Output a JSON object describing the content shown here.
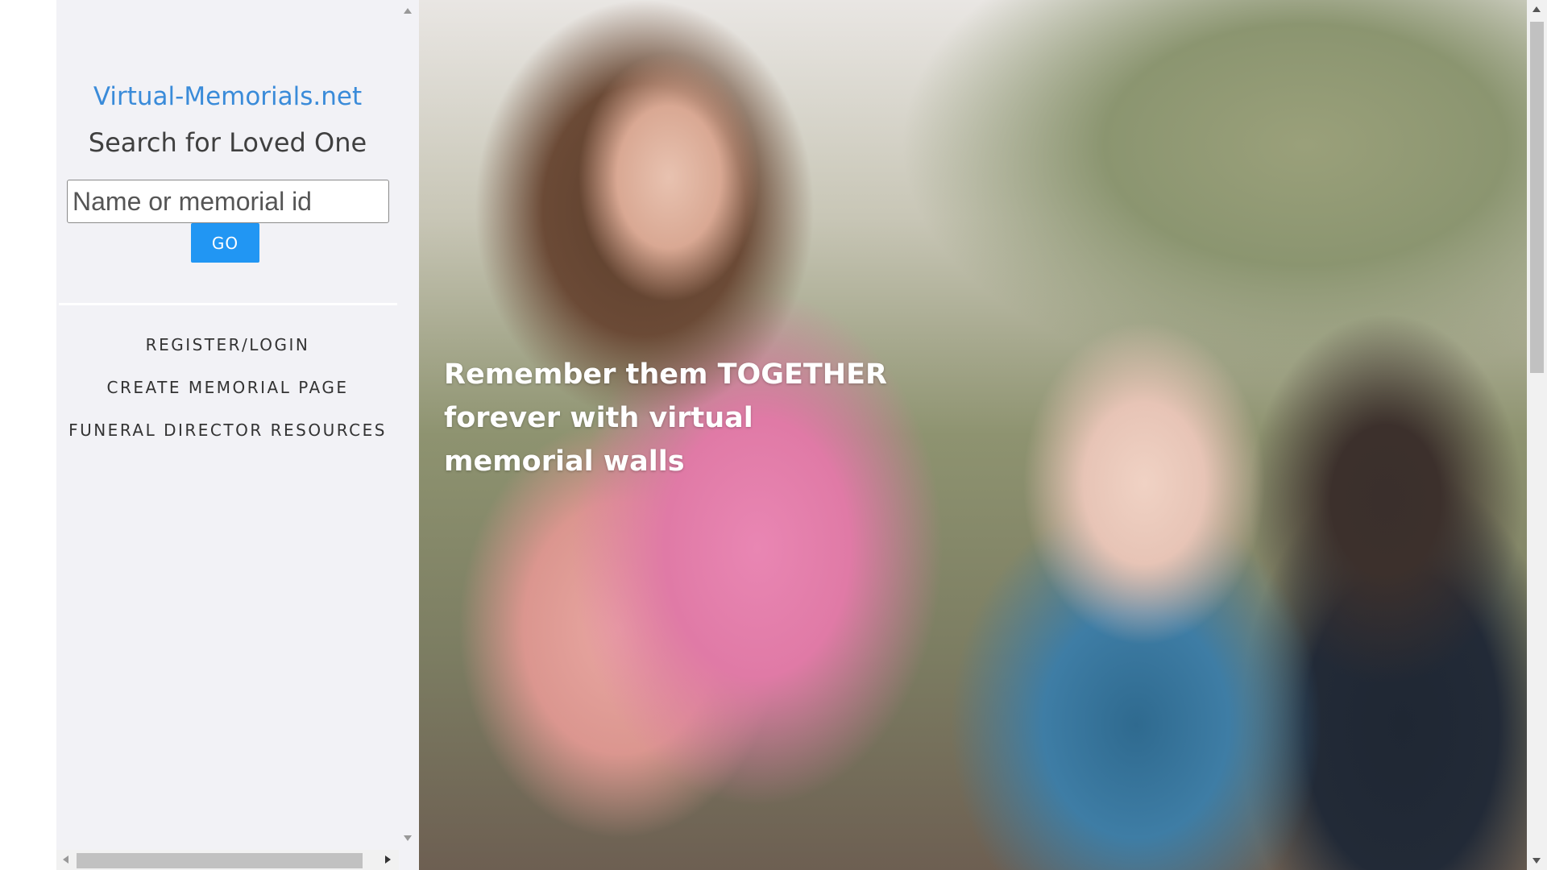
{
  "sidebar": {
    "site_title": "Virtual-Memorials.net",
    "search_heading": "Search for Loved One",
    "search_placeholder": "Name or memorial id",
    "search_value": "",
    "go_label": "GO",
    "nav": [
      {
        "label": "REGISTER/LOGIN"
      },
      {
        "label": "CREATE MEMORIAL PAGE"
      },
      {
        "label": "FUNERAL DIRECTOR RESOURCES"
      }
    ]
  },
  "hero": {
    "headline": "Remember them TOGETHER forever with virtual memorial walls"
  },
  "icons": {
    "scroll_up": "scroll-up-arrow-icon",
    "scroll_down": "scroll-down-arrow-icon",
    "scroll_left": "scroll-left-arrow-icon",
    "scroll_right": "scroll-right-arrow-icon"
  },
  "colors": {
    "brand": "#3a8bd9",
    "button": "#2196f3",
    "sidebar_bg": "#f2f2f6"
  }
}
